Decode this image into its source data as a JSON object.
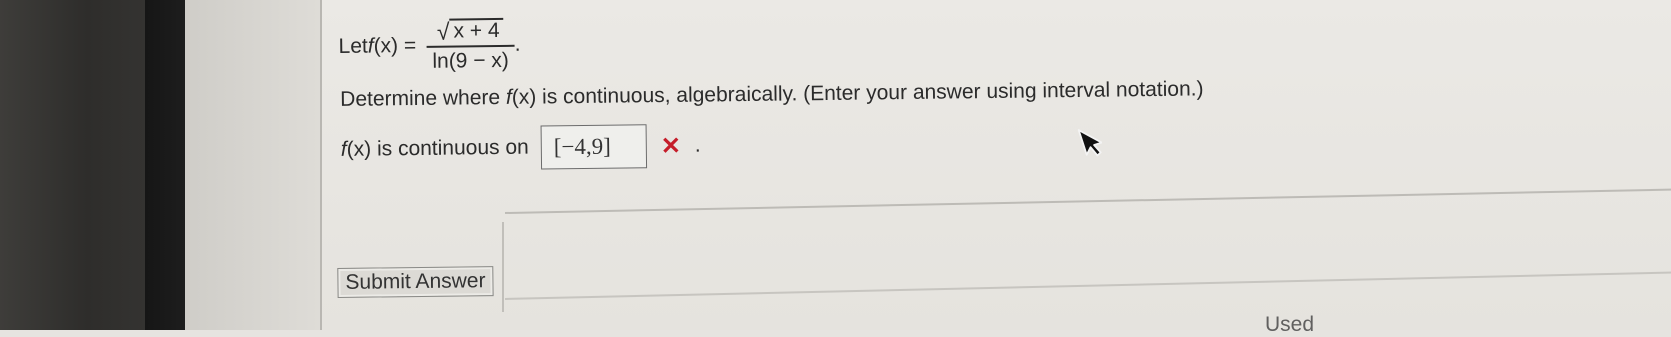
{
  "problem": {
    "let_prefix": "Let ",
    "function_name": "f",
    "function_arg": "(x) =",
    "numerator_sqrt": "√",
    "numerator_radicand": "x + 4",
    "denominator": "ln(9 − x)",
    "end_period": ".",
    "instruction_prefix": "Determine where ",
    "instruction_fn": "f",
    "instruction_suffix": "(x) is continuous, algebraically. (Enter your answer using interval notation.)"
  },
  "answer": {
    "label_fn": "f",
    "label_suffix": "(x) is continuous on",
    "value": "[−4,9]",
    "status_mark": "✕",
    "status_color": "#c51d2a",
    "trailing": "."
  },
  "submit": {
    "label": "Submit Answer"
  },
  "footer": {
    "partial_text": "Used"
  }
}
